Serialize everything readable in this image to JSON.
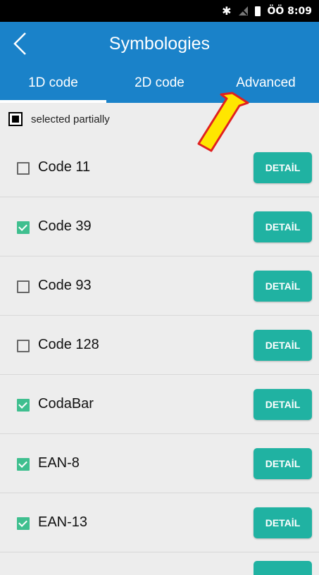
{
  "status_bar": {
    "bluetooth_icon": "bluetooth-icon",
    "signal_icon": "no-signal-icon",
    "battery_icon": "battery-icon",
    "time": "ÖÖ 8:09"
  },
  "header": {
    "title": "Symbologies",
    "back_icon": "chevron-left-icon"
  },
  "tabs": [
    {
      "label": "1D code",
      "active": true
    },
    {
      "label": "2D code",
      "active": false
    },
    {
      "label": "Advanced",
      "active": false
    }
  ],
  "select_all": {
    "label": "selected partially",
    "state": "indeterminate"
  },
  "symbologies": [
    {
      "name": "Code 11",
      "checked": false,
      "button": "DETAİL"
    },
    {
      "name": "Code 39",
      "checked": true,
      "button": "DETAİL"
    },
    {
      "name": "Code 93",
      "checked": false,
      "button": "DETAİL"
    },
    {
      "name": "Code 128",
      "checked": false,
      "button": "DETAİL"
    },
    {
      "name": "CodaBar",
      "checked": true,
      "button": "DETAİL"
    },
    {
      "name": "EAN-8",
      "checked": true,
      "button": "DETAİL"
    },
    {
      "name": "EAN-13",
      "checked": true,
      "button": "DETAİL"
    }
  ],
  "colors": {
    "primary": "#1a82c9",
    "accent_button": "#20b2a2",
    "checkbox_checked": "#3fbf8f",
    "arrow_fill": "#ffe600",
    "arrow_stroke": "#e02020"
  }
}
